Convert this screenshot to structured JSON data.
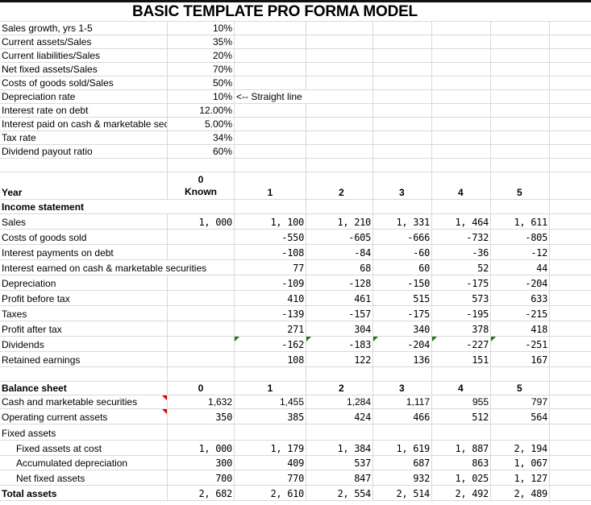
{
  "title": "BASIC TEMPLATE PRO FORMA MODEL",
  "parameters": [
    {
      "label": "Sales growth, yrs 1-5",
      "value": "10%",
      "note": ""
    },
    {
      "label": "Current assets/Sales",
      "value": "35%",
      "note": ""
    },
    {
      "label": "Current liabilities/Sales",
      "value": "20%",
      "note": ""
    },
    {
      "label": "Net fixed assets/Sales",
      "value": "70%",
      "note": ""
    },
    {
      "label": "Costs of goods sold/Sales",
      "value": "50%",
      "note": ""
    },
    {
      "label": "Depreciation rate",
      "value": "10%",
      "note": "<-- Straight line"
    },
    {
      "label": "Interest rate on debt",
      "value": "12.00%",
      "note": ""
    },
    {
      "label": "Interest paid on cash & marketable securities",
      "value": "5.00%",
      "note": ""
    },
    {
      "label": "Tax rate",
      "value": "34%",
      "note": ""
    },
    {
      "label": "Dividend payout ratio",
      "value": "60%",
      "note": ""
    }
  ],
  "income_header": {
    "label": "Year",
    "year0_top": "0",
    "year0_bottom": "Known",
    "years": [
      "1",
      "2",
      "3",
      "4",
      "5"
    ]
  },
  "income_statement": {
    "label": "Income statement",
    "rows": [
      {
        "label": "Sales",
        "values": [
          "1, 000",
          "1, 100",
          "1, 210",
          "1, 331",
          "1, 464",
          "1, 611"
        ]
      },
      {
        "label": "Costs of goods sold",
        "values": [
          "",
          "-550",
          "-605",
          "-666",
          "-732",
          "-805"
        ]
      },
      {
        "label": "Interest payments on debt",
        "values": [
          "",
          "-108",
          "-84",
          "-60",
          "-36",
          "-12"
        ]
      },
      {
        "label": "Interest earned on cash & marketable securities",
        "values": [
          "",
          "77",
          "68",
          "60",
          "52",
          "44"
        ]
      },
      {
        "label": "Depreciation",
        "values": [
          "",
          "-109",
          "-128",
          "-150",
          "-175",
          "-204"
        ]
      },
      {
        "label": "Profit before tax",
        "values": [
          "",
          "410",
          "461",
          "515",
          "573",
          "633"
        ]
      },
      {
        "label": "Taxes",
        "values": [
          "",
          "-139",
          "-157",
          "-175",
          "-195",
          "-215"
        ]
      },
      {
        "label": "Profit after tax",
        "values": [
          "",
          "271",
          "304",
          "340",
          "378",
          "418"
        ]
      },
      {
        "label": "Dividends",
        "values": [
          "",
          "-162",
          "-183",
          "-204",
          "-227",
          "-251"
        ]
      },
      {
        "label": "Retained earnings",
        "values": [
          "",
          "108",
          "122",
          "136",
          "151",
          "167"
        ]
      }
    ]
  },
  "balance_sheet": {
    "label": "Balance sheet",
    "years": [
      "0",
      "1",
      "2",
      "3",
      "4",
      "5"
    ],
    "rows": [
      {
        "label": "Cash and marketable securities",
        "values": [
          "1,632",
          "1,455",
          "1,284",
          "1,117",
          "955",
          "797"
        ]
      },
      {
        "label": "Operating current assets",
        "values": [
          "350",
          "385",
          "424",
          "466",
          "512",
          "564"
        ]
      },
      {
        "label": "Fixed assets",
        "values": [
          "",
          "",
          "",
          "",
          "",
          ""
        ]
      },
      {
        "label": "Fixed assets at cost",
        "values": [
          "1, 000",
          "1, 179",
          "1, 384",
          "1, 619",
          "1, 887",
          "2, 194"
        ]
      },
      {
        "label": "Accumulated depreciation",
        "values": [
          "300",
          "409",
          "537",
          "687",
          "863",
          "1, 067"
        ]
      },
      {
        "label": "Net fixed assets",
        "values": [
          "700",
          "770",
          "847",
          "932",
          "1, 025",
          "1, 127"
        ]
      },
      {
        "label": "Total assets",
        "values": [
          "2, 682",
          "2, 610",
          "2, 554",
          "2, 514",
          "2, 492",
          "2, 489"
        ]
      }
    ]
  },
  "indicators": {
    "green_comment_color": "#1a7a1a",
    "red_comment_color": "#e00000"
  }
}
